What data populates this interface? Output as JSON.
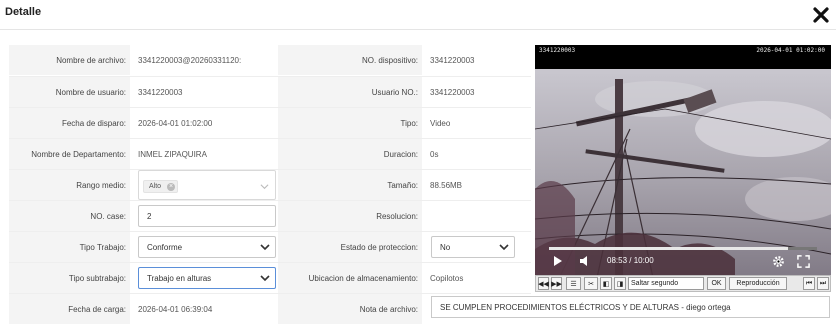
{
  "dialog": {
    "title": "Detalle"
  },
  "rows": [
    {
      "label": "Nombre de archivo:",
      "value": "3341220003@20260331120:",
      "label2": "NO. dispositivo:",
      "value2": "3341220003"
    },
    {
      "label": "Nombre de usuario:",
      "value": "3341220003",
      "label2": "Usuario NO.:",
      "value2": "3341220003"
    },
    {
      "label": "Fecha de disparo:",
      "value": "2026-04-01 01:02:00",
      "label2": "Tipo:",
      "value2": "Video"
    },
    {
      "label": "Nombre de Departamento:",
      "value": "INMEL ZIPAQUIRA",
      "label2": "Duracion:",
      "value2": "0s"
    },
    {
      "label": "Rango medio:",
      "value": "Alto",
      "label2": "Tamaño:",
      "value2": "88.56MB"
    },
    {
      "label": "NO. case:",
      "value": "2",
      "label2": "Resolucion:",
      "value2": ""
    },
    {
      "label": "Tipo Trabajo:",
      "value": "Conforme",
      "label2": "Estado de proteccion:",
      "value2": "No"
    },
    {
      "label": "Tipo subtrabajo:",
      "value": "Trabajo en alturas",
      "label2": "Ubicacion de almacenamiento:",
      "value2": "Copilotos"
    },
    {
      "label": "Fecha de carga:",
      "value": "2026-04-01 06:39:04",
      "label2": "Nota de archivo:",
      "value2": "SE CUMPLEN PROCEDIMIENTOS ELÉCTRICOS Y DE ALTURAS - diego ortega"
    }
  ],
  "player": {
    "time": "08:53 / 10:00",
    "progress": 0.89,
    "osd_left": "3341220003",
    "osd_right": "2026-04-01 01:02:00"
  },
  "toolbar": {
    "seek_placeholder": "Saltar segundo",
    "ok_label": "OK",
    "playback_label": "Reproducción"
  },
  "colors": {
    "label_bg": "#f4f4f4",
    "focus_border": "#5b8fd9",
    "video_bg": "#000000"
  }
}
